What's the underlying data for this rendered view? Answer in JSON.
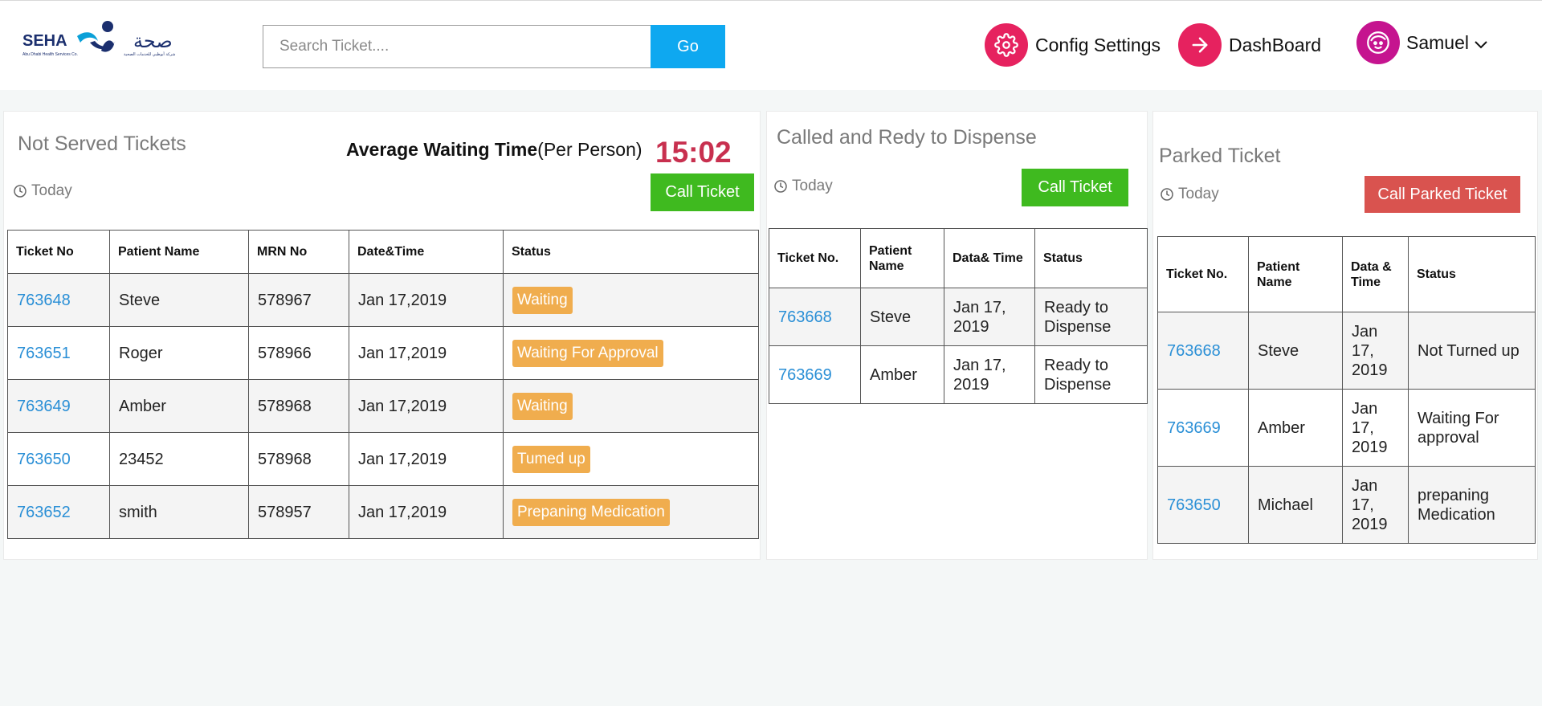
{
  "header": {
    "logo_text_en": "SEHA",
    "logo_text_ar": "صحة",
    "logo_sub_en": "Abu Dhabi Health Services Co.",
    "logo_sub_ar": "شركة أبوظبي للخدمات الصحية",
    "search_placeholder": "Search Ticket....",
    "search_value": "",
    "go_label": "Go",
    "config_label": "Config Settings",
    "dashboard_label": "DashBoard",
    "user_name": "Samuel"
  },
  "not_served": {
    "title": "Not Served Tickets",
    "avg_label_bold": "Average Waiting Time",
    "avg_label_rest": "(Per Person)",
    "avg_value": "15:02",
    "today": "Today",
    "call_button": "Call Ticket",
    "columns": [
      "Ticket No",
      "Patient Name",
      "MRN No",
      "Date&Time",
      "Status"
    ],
    "rows": [
      {
        "ticket": "763648",
        "name": "Steve",
        "mrn": "578967",
        "date": "Jan 17,2019",
        "status": "Waiting"
      },
      {
        "ticket": "763651",
        "name": "Roger",
        "mrn": "578966",
        "date": "Jan 17,2019",
        "status": "Waiting For Approval"
      },
      {
        "ticket": "763649",
        "name": "Amber",
        "mrn": "578968",
        "date": "Jan 17,2019",
        "status": "Waiting"
      },
      {
        "ticket": "763650",
        "name": "23452",
        "mrn": "578968",
        "date": "Jan 17,2019",
        "status": "Tumed up"
      },
      {
        "ticket": "763652",
        "name": "smith",
        "mrn": "578957",
        "date": "Jan 17,2019",
        "status": "Prepaning Medication"
      }
    ]
  },
  "called": {
    "title": "Called and Redy to Dispense",
    "today": "Today",
    "call_button": "Call Ticket",
    "columns": [
      "Ticket No.",
      "Patient Name",
      "Data& Time",
      "Status"
    ],
    "rows": [
      {
        "ticket": "763668",
        "name": "Steve",
        "date": "Jan 17, 2019",
        "status": "Ready to Dispense"
      },
      {
        "ticket": "763669",
        "name": "Amber",
        "date": "Jan 17, 2019",
        "status": "Ready to Dispense"
      }
    ]
  },
  "parked": {
    "title": "Parked Ticket",
    "today": "Today",
    "call_button": "Call Parked Ticket",
    "columns": [
      "Ticket No.",
      "Patient Name",
      "Data & Time",
      "Status"
    ],
    "rows": [
      {
        "ticket": "763668",
        "name": "Steve",
        "date": "Jan 17, 2019",
        "status": "Not Turned up"
      },
      {
        "ticket": "763669",
        "name": "Amber",
        "date": "Jan 17, 2019",
        "status": "Waiting For approval"
      },
      {
        "ticket": "763650",
        "name": "Michael",
        "date": "Jan 17, 2019",
        "status": "prepaning Medication"
      }
    ]
  },
  "colors": {
    "accent_blue": "#0ea8f0",
    "icon_pink": "#e6225f",
    "avatar_magenta": "#c5148f",
    "call_green": "#3fba1f",
    "call_red": "#d9534f",
    "status_orange": "#f0ad4e",
    "timer_red": "#c8304f",
    "link_blue": "#2a8fd6"
  }
}
